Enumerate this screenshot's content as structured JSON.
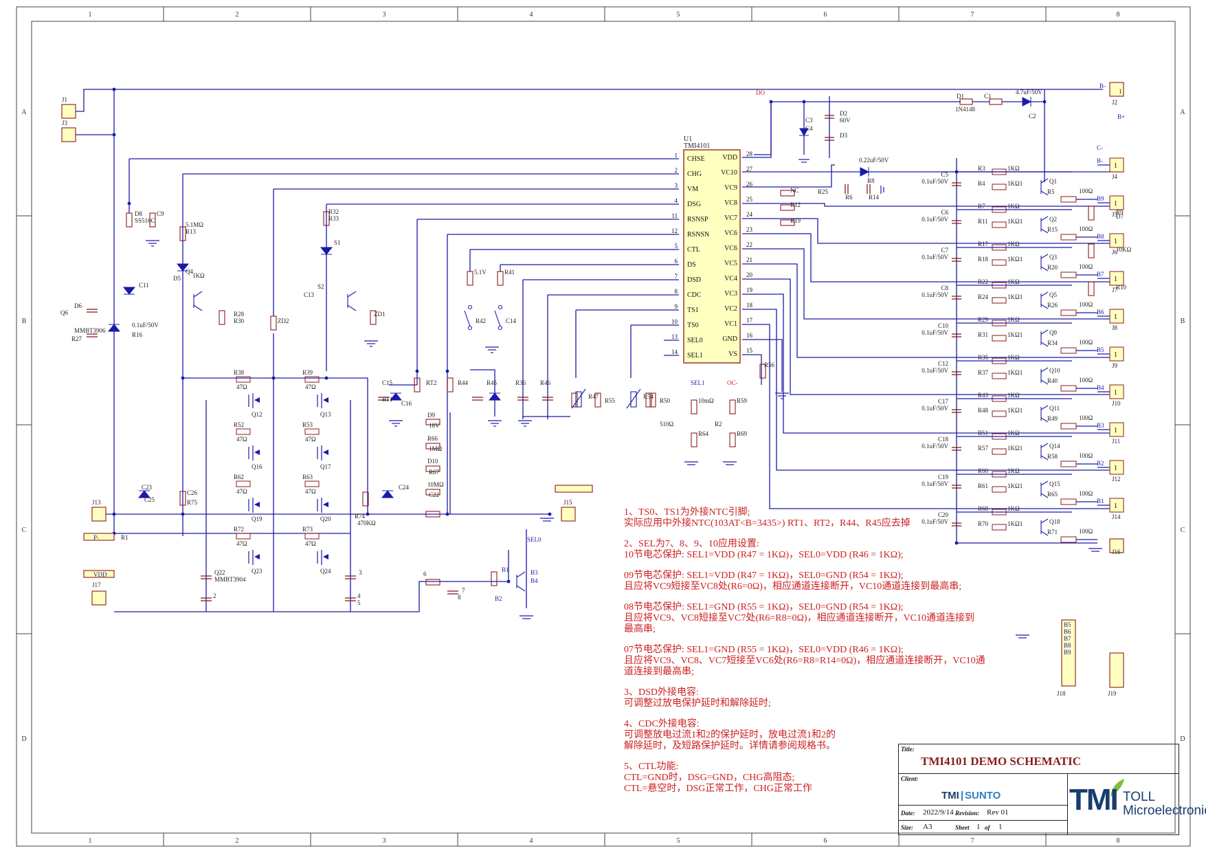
{
  "frame": {
    "col_numbers": [
      "1",
      "2",
      "3",
      "4",
      "5",
      "6",
      "7",
      "8"
    ],
    "row_letters": [
      "A",
      "B",
      "C",
      "D"
    ]
  },
  "ic": {
    "ref": "U1",
    "part": "TMI4101",
    "left_pins": [
      {
        "num": "1",
        "name": "CHSE"
      },
      {
        "num": "2",
        "name": "CHG"
      },
      {
        "num": "3",
        "name": "VM"
      },
      {
        "num": "4",
        "name": "DSG"
      },
      {
        "num": "11",
        "name": "RSNSP"
      },
      {
        "num": "12",
        "name": "RSNSN"
      },
      {
        "num": "5",
        "name": "CTL"
      },
      {
        "num": "6",
        "name": "DS"
      },
      {
        "num": "7",
        "name": "DSD"
      },
      {
        "num": "8",
        "name": "CDC"
      },
      {
        "num": "9",
        "name": "TS1"
      },
      {
        "num": "10",
        "name": "TS0"
      },
      {
        "num": "13",
        "name": "SEL0"
      },
      {
        "num": "14",
        "name": "SEL1"
      }
    ],
    "right_pins": [
      {
        "num": "28",
        "name": "VDD"
      },
      {
        "num": "27",
        "name": "VC10"
      },
      {
        "num": "26",
        "name": "VC9"
      },
      {
        "num": "25",
        "name": "VC8"
      },
      {
        "num": "24",
        "name": "VC7"
      },
      {
        "num": "23",
        "name": "VC6"
      },
      {
        "num": "22",
        "name": "VC6"
      },
      {
        "num": "21",
        "name": "VC5"
      },
      {
        "num": "20",
        "name": "VC4"
      },
      {
        "num": "19",
        "name": "VC3"
      },
      {
        "num": "18",
        "name": "VC2"
      },
      {
        "num": "17",
        "name": "VC1"
      },
      {
        "num": "16",
        "name": "GND"
      },
      {
        "num": "15",
        "name": "VS"
      }
    ]
  },
  "cell_rows": [
    {
      "c": "C5",
      "cv": "0.1uF/50V",
      "ra": "R3",
      "rav": "1KΩ",
      "rb": "R4",
      "rbv": "1KΩ1",
      "q": "Q1",
      "rs": "R5",
      "rsv": "100Ω",
      "jn": "B-",
      "jr": "J4",
      "pin": "1"
    },
    {
      "c": "C6",
      "cv": "0.1uF/50V",
      "ra": "R7",
      "rav": "1KΩ",
      "rb": "R11",
      "rbv": "1KΩ1",
      "q": "Q2",
      "rs": "R15",
      "rsv": "100Ω",
      "jn": "B9",
      "jr": "J5",
      "pin": "1"
    },
    {
      "c": "C7",
      "cv": "0.1uF/50V",
      "ra": "R17",
      "rav": "1KΩ",
      "rb": "R18",
      "rbv": "1KΩ1",
      "q": "Q3",
      "rs": "R20",
      "rsv": "100Ω",
      "jn": "B8",
      "jr": "J6",
      "pin": "1"
    },
    {
      "c": "C8",
      "cv": "0.1uF/50V",
      "ra": "R22",
      "rav": "1KΩ",
      "rb": "R24",
      "rbv": "1KΩ1",
      "q": "Q5",
      "rs": "R26",
      "rsv": "100Ω",
      "jn": "B7",
      "jr": "J7",
      "pin": "1"
    },
    {
      "c": "C10",
      "cv": "0.1uF/50V",
      "ra": "R29",
      "rav": "1KΩ",
      "rb": "R31",
      "rbv": "1KΩ1",
      "q": "Q9",
      "rs": "R34",
      "rsv": "100Ω",
      "jn": "B6",
      "jr": "J8",
      "pin": "1"
    },
    {
      "c": "C12",
      "cv": "0.1uF/50V",
      "ra": "R35",
      "rav": "1KΩ",
      "rb": "R37",
      "rbv": "1KΩ1",
      "q": "Q10",
      "rs": "R40",
      "rsv": "100Ω",
      "jn": "B5",
      "jr": "J9",
      "pin": "1"
    },
    {
      "c": "C17",
      "cv": "0.1uF/50V",
      "ra": "R43",
      "rav": "1KΩ",
      "rb": "R48",
      "rbv": "1KΩ1",
      "q": "Q11",
      "rs": "R49",
      "rsv": "100Ω",
      "jn": "B4",
      "jr": "J10",
      "pin": "1"
    },
    {
      "c": "C18",
      "cv": "0.1uF/50V",
      "ra": "R51",
      "rav": "1KΩ",
      "rb": "R57",
      "rbv": "1KΩ1",
      "q": "Q14",
      "rs": "R58",
      "rsv": "100Ω",
      "jn": "B3",
      "jr": "J11",
      "pin": "1"
    },
    {
      "c": "C19",
      "cv": "0.1uF/50V",
      "ra": "R60",
      "rav": "1KΩ",
      "rb": "R61",
      "rbv": "1KΩ1",
      "q": "Q15",
      "rs": "R65",
      "rsv": "100Ω",
      "jn": "B2",
      "jr": "J12",
      "pin": "1"
    },
    {
      "c": "C20",
      "cv": "0.1uF/50V",
      "ra": "R68",
      "rav": "1KΩ",
      "rb": "R70",
      "rbv": "1KΩ1",
      "q": "Q18",
      "rs": "R71",
      "rsv": "100Ω",
      "jn": "B1",
      "jr": "J14",
      "pin": "1"
    }
  ],
  "mosfets": [
    {
      "r": "R38",
      "rv": "47Ω",
      "q": "Q12"
    },
    {
      "r": "R39",
      "rv": "47Ω",
      "q": "Q13"
    },
    {
      "r": "R52",
      "rv": "47Ω",
      "q": "Q16"
    },
    {
      "r": "R53",
      "rv": "47Ω",
      "q": "Q17"
    },
    {
      "r": "R62",
      "rv": "47Ω",
      "q": "Q19"
    },
    {
      "r": "R63",
      "rv": "47Ω",
      "q": "Q20"
    },
    {
      "r": "R72",
      "rv": "47Ω",
      "q": "Q23"
    },
    {
      "r": "R73",
      "rv": "47Ω",
      "q": "Q24"
    }
  ],
  "labels": [
    {
      "t": "J1",
      "k": "ref"
    },
    {
      "t": "J3",
      "k": "ref"
    },
    {
      "t": "J2",
      "k": "ref"
    },
    {
      "t": "J13",
      "k": "ref"
    },
    {
      "t": "J15",
      "k": "ref"
    },
    {
      "t": "J16",
      "k": "ref"
    },
    {
      "t": "J17",
      "k": "ref"
    },
    {
      "t": "J18",
      "k": "ref"
    },
    {
      "t": "J19",
      "k": "ref"
    },
    {
      "t": "1",
      "k": "pin"
    },
    {
      "t": "B+",
      "k": "net"
    },
    {
      "t": "B-",
      "k": "net"
    },
    {
      "t": "C-",
      "k": "net"
    },
    {
      "t": "P-",
      "k": "net"
    },
    {
      "t": "VDD",
      "k": "net"
    },
    {
      "t": "DO",
      "k": "net"
    },
    {
      "t": "SEL0",
      "k": "net"
    },
    {
      "t": "SEL1",
      "k": "net"
    },
    {
      "t": "OC-",
      "k": "net"
    },
    {
      "t": "R1",
      "k": "ref"
    },
    {
      "t": "510Ω",
      "k": "val"
    },
    {
      "t": "R2",
      "k": "ref"
    },
    {
      "t": "D1",
      "k": "ref"
    },
    {
      "t": "1N4148",
      "k": "val"
    },
    {
      "t": "C1",
      "k": "ref"
    },
    {
      "t": "4.7uF/50V",
      "k": "val"
    },
    {
      "t": "C2",
      "k": "ref"
    },
    {
      "t": "D2",
      "k": "ref"
    },
    {
      "t": "60V",
      "k": "val"
    },
    {
      "t": "D3",
      "k": "ref"
    },
    {
      "t": "C3",
      "k": "ref"
    },
    {
      "t": "C4",
      "k": "ref"
    },
    {
      "t": "0.22uF/50V",
      "k": "val"
    },
    {
      "t": "R6",
      "k": "ref"
    },
    {
      "t": "R8",
      "k": "ref"
    },
    {
      "t": "R14",
      "k": "ref"
    },
    {
      "t": "NC",
      "k": "val"
    },
    {
      "t": "R12",
      "k": "ref"
    },
    {
      "t": "R19",
      "k": "ref"
    },
    {
      "t": "R25",
      "k": "ref"
    },
    {
      "t": "R9",
      "k": "ref"
    },
    {
      "t": "10KΩ",
      "k": "val"
    },
    {
      "t": "R10",
      "k": "ref"
    },
    {
      "t": "D7",
      "k": "ref"
    },
    {
      "t": "D8",
      "k": "ref"
    },
    {
      "t": "SS510C",
      "k": "val"
    },
    {
      "t": "C9",
      "k": "ref"
    },
    {
      "t": "C11",
      "k": "ref"
    },
    {
      "t": "0.1uF/50V",
      "k": "val"
    },
    {
      "t": "R16",
      "k": "ref"
    },
    {
      "t": "D6",
      "k": "ref"
    },
    {
      "t": "Q6",
      "k": "ref"
    },
    {
      "t": "MMBT3906",
      "k": "val"
    },
    {
      "t": "R27",
      "k": "ref"
    },
    {
      "t": "5.1MΩ",
      "k": "val"
    },
    {
      "t": "R13",
      "k": "ref"
    },
    {
      "t": "1KΩ",
      "k": "val"
    },
    {
      "t": "D5",
      "k": "ref"
    },
    {
      "t": "Q4",
      "k": "ref"
    },
    {
      "t": "R28",
      "k": "ref"
    },
    {
      "t": "R30",
      "k": "ref"
    },
    {
      "t": "R32",
      "k": "ref"
    },
    {
      "t": "R33",
      "k": "ref"
    },
    {
      "t": "S1",
      "k": "ref"
    },
    {
      "t": "S2",
      "k": "ref"
    },
    {
      "t": "C13",
      "k": "ref"
    },
    {
      "t": "ZD1",
      "k": "ref"
    },
    {
      "t": "ZD2",
      "k": "ref"
    },
    {
      "t": "5.1V",
      "k": "val"
    },
    {
      "t": "R41",
      "k": "ref"
    },
    {
      "t": "R42",
      "k": "ref"
    },
    {
      "t": "C14",
      "k": "ref"
    },
    {
      "t": "C15",
      "k": "ref"
    },
    {
      "t": "C16",
      "k": "ref"
    },
    {
      "t": "RT1",
      "k": "ref"
    },
    {
      "t": "RT2",
      "k": "ref"
    },
    {
      "t": "R44",
      "k": "ref"
    },
    {
      "t": "R45",
      "k": "ref"
    },
    {
      "t": "R36",
      "k": "ref"
    },
    {
      "t": "R46",
      "k": "ref"
    },
    {
      "t": "R47",
      "k": "ref"
    },
    {
      "t": "R54",
      "k": "ref"
    },
    {
      "t": "R55",
      "k": "ref"
    },
    {
      "t": "R50",
      "k": "ref"
    },
    {
      "t": "R56",
      "k": "ref"
    },
    {
      "t": "10mΩ",
      "k": "val"
    },
    {
      "t": "R59",
      "k": "ref"
    },
    {
      "t": "R64",
      "k": "ref"
    },
    {
      "t": "R69",
      "k": "ref"
    },
    {
      "t": "D9",
      "k": "ref"
    },
    {
      "t": "18V",
      "k": "val"
    },
    {
      "t": "R66",
      "k": "ref"
    },
    {
      "t": "1MΩ",
      "k": "val"
    },
    {
      "t": "D10",
      "k": "ref"
    },
    {
      "t": "R67",
      "k": "ref"
    },
    {
      "t": "10MΩ",
      "k": "val"
    },
    {
      "t": "C22",
      "k": "ref"
    },
    {
      "t": "C23",
      "k": "ref"
    },
    {
      "t": "C25",
      "k": "ref"
    },
    {
      "t": "C26",
      "k": "ref"
    },
    {
      "t": "R75",
      "k": "ref"
    },
    {
      "t": "C24",
      "k": "ref"
    },
    {
      "t": "R74",
      "k": "ref"
    },
    {
      "t": "470KΩ",
      "k": "val"
    },
    {
      "t": "Q22",
      "k": "ref"
    },
    {
      "t": "MMBT3904",
      "k": "val"
    },
    {
      "t": "2",
      "k": "pin"
    },
    {
      "t": "3",
      "k": "pin"
    },
    {
      "t": "4",
      "k": "pin"
    },
    {
      "t": "5",
      "k": "pin"
    },
    {
      "t": "6",
      "k": "pin"
    },
    {
      "t": "7",
      "k": "pin"
    },
    {
      "t": "8",
      "k": "pin"
    },
    {
      "t": "B1",
      "k": "net"
    },
    {
      "t": "B2",
      "k": "net"
    },
    {
      "t": "B3",
      "k": "net"
    },
    {
      "t": "B4",
      "k": "net"
    },
    {
      "t": "B5",
      "k": "net"
    },
    {
      "t": "B6",
      "k": "net"
    },
    {
      "t": "B7",
      "k": "net"
    },
    {
      "t": "B8",
      "k": "net"
    },
    {
      "t": "B9",
      "k": "net"
    }
  ],
  "notes": [
    [
      "1、TS0、TS1为外接NTC引脚;",
      "实际应用中外接NTC(103AT<B=3435>) RT1、RT2，R44、R45应去掉"
    ],
    [
      "2、SEL为7、8、9、10应用设置:",
      "10节电芯保护: SEL1=VDD (R47 = 1KΩ)，SEL0=VDD (R46 = 1KΩ);"
    ],
    [
      "09节电芯保护: SEL1=VDD (R47 = 1KΩ)，SEL0=GND (R54 = 1KΩ);",
      "且应将VC9短接至VC8处(R6=0Ω)，相应通道连接断开，VC10通道连接到最高串;"
    ],
    [
      "08节电芯保护: SEL1=GND (R55 = 1KΩ)，SEL0=GND (R54 = 1KΩ);",
      "且应将VC9、VC8短接至VC7处(R6=R8=0Ω)，相应通道连接断开，VC10通道连接到",
      "最高串;"
    ],
    [
      "07节电芯保护: SEL1=GND (R55 = 1KΩ)，SEL0=VDD (R46 = 1KΩ);",
      "且应将VC9、VC8、VC7短接至VC6处(R6=R8=R14=0Ω)，相应通道连接断开，VC10通",
      "道连接到最高串;"
    ],
    [
      "3、DSD外接电容:",
      "可调整过放电保护延时和解除延时;"
    ],
    [
      "4、CDC外接电容:",
      "可调整放电过流1和2的保护延时，放电过流1和2的",
      "解除延时，及短路保护延时。详情请参阅规格书。"
    ],
    [
      "5、CTL功能:",
      "CTL=GND时，DSG=GND，CHG高阻态;",
      "CTL=悬空时，DSG正常工作，CHG正常工作"
    ]
  ],
  "title_block": {
    "title_label": "Title:",
    "title": "TMI4101 DEMO SCHEMATIC",
    "client_label": "Client:",
    "client_logo_a": "TMI",
    "client_logo_b": "SUNTO",
    "date_label": "Date:",
    "date": "2022/9/14",
    "revision_label": "Revision:",
    "revision": "Rev 01",
    "size_label": "Size:",
    "size": "A3",
    "sheet_label": "Sheet",
    "sheet_num": "1",
    "of_label": "of",
    "sheet_total": "1",
    "logo_tmi": "TMI",
    "logo_line1": "TOLL",
    "logo_line2": "Microelectronic"
  },
  "colors": {
    "wire": "#1a1aa8",
    "label_blue": "#1a1aa8",
    "label_red": "#cc1f1f",
    "ic_fill": "#ffffc0",
    "frame": "#444444",
    "ref_text": "#222222"
  }
}
